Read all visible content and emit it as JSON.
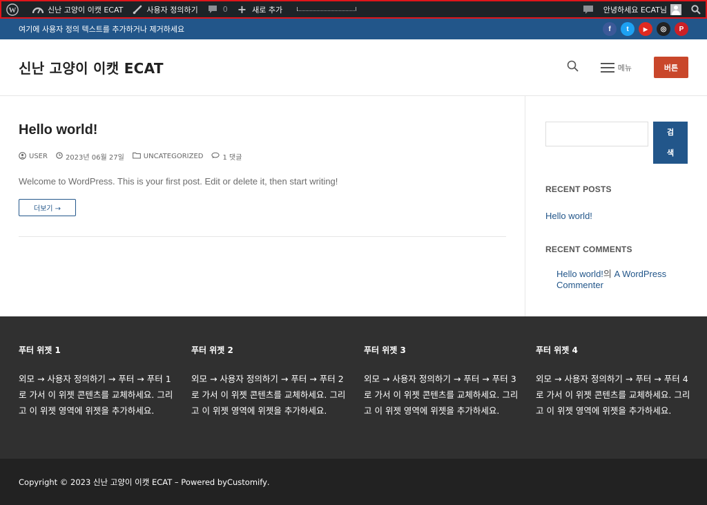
{
  "adminbar": {
    "site_name": "신난 고양이 이캣 ECAT",
    "customize": "사용자 정의하기",
    "comments_count": "0",
    "new_label": "새로 추가",
    "greeting": "안녕하세요 ECAT님"
  },
  "topbar": {
    "text": "여기에 사용자 정의 텍스트를 추가하거나 제거하세요",
    "socials": [
      {
        "label": "f",
        "color": "#3b5998"
      },
      {
        "label": "t",
        "color": "#1da1f2"
      },
      {
        "label": "▶",
        "color": "#e02a20"
      },
      {
        "label": "◎",
        "color": "#222222"
      },
      {
        "label": "P",
        "color": "#cb2027"
      }
    ]
  },
  "header": {
    "site_title": "신난 고양이 이캣 ECAT",
    "menu_label": "메뉴",
    "button_label": "버튼"
  },
  "post": {
    "title": "Hello world!",
    "author": "USER",
    "date": "2023년 06월 27일",
    "category": "UNCATEGORIZED",
    "comments": "1 댓글",
    "excerpt": "Welcome to WordPress. This is your first post. Edit or delete it, then start writing!",
    "more": "더보기 →"
  },
  "sidebar": {
    "search_button": "검색",
    "recent_posts_title": "RECENT POSTS",
    "recent_post": "Hello world!",
    "recent_comments_title": "RECENT COMMENTS",
    "comment_post": "Hello world!",
    "comment_mid": "의 ",
    "comment_author": "A WordPress Commenter"
  },
  "footer": {
    "widgets": [
      {
        "title": "푸터 위젯 1",
        "text": "외모 → 사용자 정의하기 → 푸터 → 푸터 1로 가서 이 위젯 콘텐츠를 교체하세요. 그리고 이 위젯 영역에 위젯을 추가하세요."
      },
      {
        "title": "푸터 위젯 2",
        "text": "외모 → 사용자 정의하기 → 푸터 → 푸터 2로 가서 이 위젯 콘텐츠를 교체하세요. 그리고 이 위젯 영역에 위젯을 추가하세요."
      },
      {
        "title": "푸터 위젯 3",
        "text": "외모 → 사용자 정의하기 → 푸터 → 푸터 3로 가서 이 위젯 콘텐츠를 교체하세요. 그리고 이 위젯 영역에 위젯을 추가하세요."
      },
      {
        "title": "푸터 위젯 4",
        "text": "외모 → 사용자 정의하기 → 푸터 → 푸터 4로 가서 이 위젯 콘텐츠를 교체하세요. 그리고 이 위젯 영역에 위젯을 추가하세요."
      }
    ],
    "copyright": "Copyright © 2023 신난 고양이 이캣 ECAT – Powered by ",
    "powered_link": "Customify",
    "end": "."
  },
  "colors": {
    "adminbar_bg": "#1d2327",
    "primary": "#22568a",
    "accent_button": "#c9472b",
    "footer_bg": "#303030",
    "bottom_bg": "#222222"
  }
}
